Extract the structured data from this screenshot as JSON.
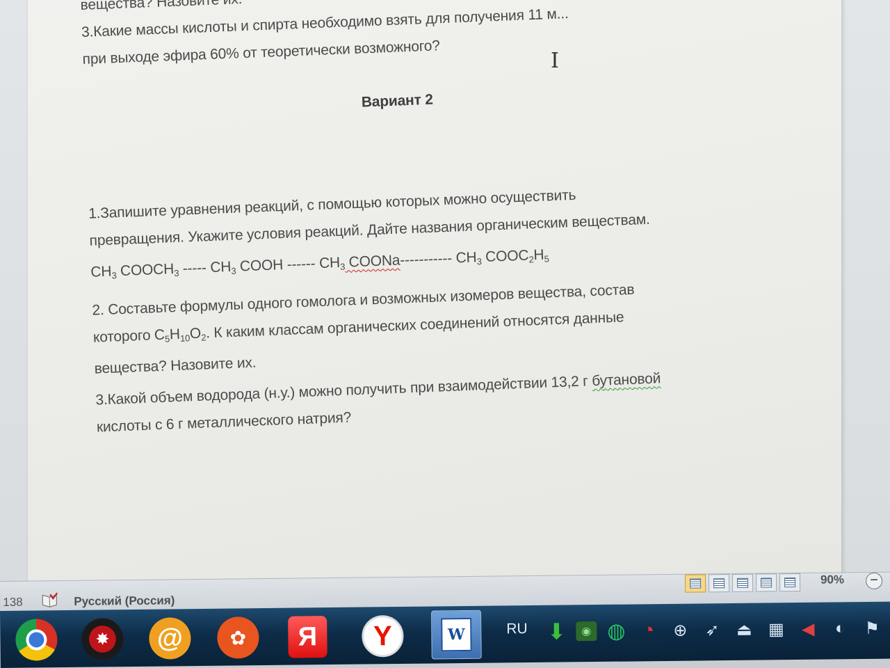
{
  "document": {
    "prev_line_tail": "вещества? Назовите их.",
    "prev_q3_line1": "3.Какие массы кислоты и спирта необходимо взять для получения 11 м...",
    "prev_q3_line2": "при выходе эфира 60% от теоретически возможного?",
    "variant_heading": "Вариант 2",
    "q1_line1": "1.Запишите уравнения реакций, с помощью которых можно осуществить",
    "q1_line2": "превращения. Укажите условия реакций. Дайте названия органическим веществам.",
    "formula": {
      "p1_a": "CH",
      "p1_sub1": "3",
      "p1_b": " COOCH",
      "p1_sub2": "3",
      "sep1": " ----- ",
      "p2_a": "CH",
      "p2_sub1": "3",
      "p2_b": " COOH",
      "sep2": " ------ ",
      "p3_a": "CH",
      "p3_sub1": "3",
      "p3_b": " COONa",
      "sep3": "----------- ",
      "p4_a": "CH",
      "p4_sub1": "3",
      "p4_b": " COOC",
      "p4_sub2": "2",
      "p4_c": "H",
      "p4_sub3": "5"
    },
    "q2_line1": "2. Составьте формулы одного гомолога и возможных изомеров вещества, состав",
    "q2_line2_a": "которого C",
    "q2_sub1": "5",
    "q2_line2_b": "H",
    "q2_sub2": "10",
    "q2_line2_c": "O",
    "q2_sub3": "2",
    "q2_line2_d": ". К каким классам органических соединений относятся данные",
    "q2_line3": "вещества? Назовите их.",
    "q3_line1_a": "3.Какой объем водорода (н.у.) можно получить при взаимодействии 13,2 г ",
    "q3_line1_spell": "бутановой",
    "q3_line2": "кислоты с 6 г металлического натрия?"
  },
  "statusbar": {
    "page_count": "138",
    "language": "Русский (Россия)",
    "zoom": "90%",
    "zoom_minus": "−"
  },
  "taskbar": {
    "input_language": "RU",
    "word_glyph": "W",
    "mail_glyph": "@",
    "yabrowser_glyph": "Я",
    "yandex_glyph": "Y"
  },
  "colors": {
    "taskbar": "#0d2c48",
    "page": "#eeeeea",
    "text": "#4a4a4a"
  }
}
